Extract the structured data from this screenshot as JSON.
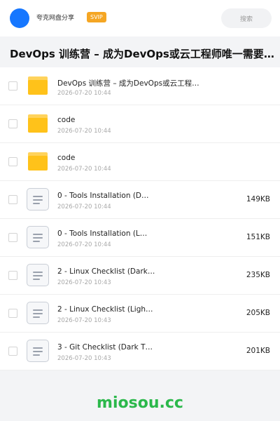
{
  "header": {
    "user_name": "夸克网盘分享",
    "badge": "SVIP",
    "search_placeholder": "搜索"
  },
  "share_title": "DevOps 训练营 – 成为DevOps或云工程师唯一需要参…",
  "files": [
    {
      "type": "folder",
      "name": "DevOps 训练营 – 成为DevOps或云工程…",
      "date": "2026-07-20 10:44",
      "size": ""
    },
    {
      "type": "folder",
      "name": "code",
      "date": "2026-07-20 10:44",
      "size": ""
    },
    {
      "type": "folder",
      "name": "code",
      "date": "2026-07-20 10:44",
      "size": ""
    },
    {
      "type": "doc",
      "name": "0 - Tools Installation (D…",
      "date": "2026-07-20 10:44",
      "size": "149KB"
    },
    {
      "type": "doc",
      "name": "0 - Tools Installation (L…",
      "date": "2026-07-20 10:44",
      "size": "151KB"
    },
    {
      "type": "doc",
      "name": "2 - Linux Checklist (Dark…",
      "date": "2026-07-20 10:43",
      "size": "235KB"
    },
    {
      "type": "doc",
      "name": "2 - Linux Checklist (Ligh…",
      "date": "2026-07-20 10:43",
      "size": "205KB"
    },
    {
      "type": "doc",
      "name": "3 - Git Checklist (Dark T…",
      "date": "2026-07-20 10:43",
      "size": "201KB"
    }
  ],
  "watermark": "miosou.cc",
  "colors": {
    "avatar": "#1677ff",
    "badge": "#f5a623",
    "folder": "#ffc21a",
    "watermark": "#2bb84b"
  }
}
